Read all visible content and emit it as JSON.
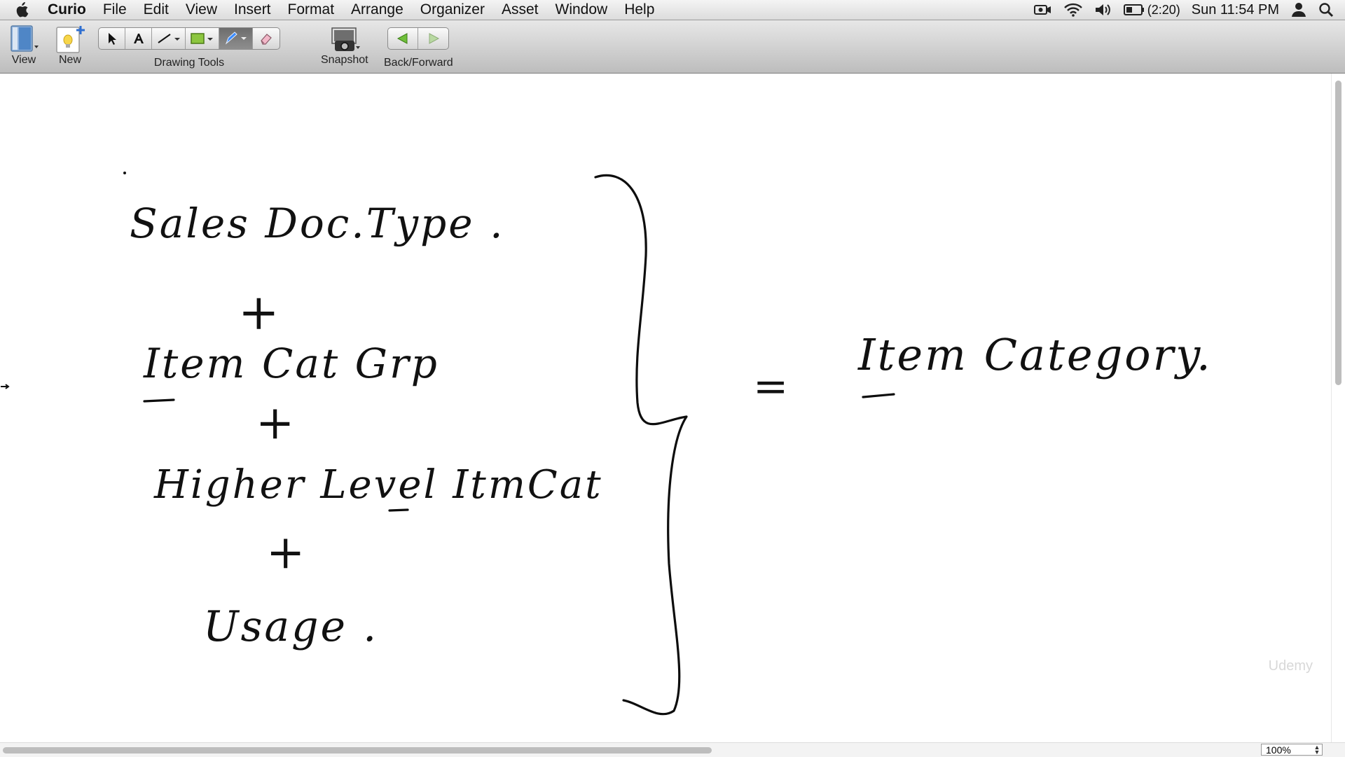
{
  "menubar": {
    "app_name": "Curio",
    "items": [
      "File",
      "Edit",
      "View",
      "Insert",
      "Format",
      "Arrange",
      "Organizer",
      "Asset",
      "Window",
      "Help"
    ],
    "battery": "(2:20)",
    "clock": "Sun 11:54 PM",
    "icons": [
      "apple-icon",
      "screen-record-icon",
      "wifi-icon",
      "volume-icon",
      "battery-icon",
      "user-icon",
      "spotlight-search-icon"
    ]
  },
  "toolbar": {
    "view_label": "View",
    "new_label": "New",
    "drawing_tools_label": "Drawing Tools",
    "snapshot_label": "Snapshot",
    "back_forward_label": "Back/Forward",
    "tools": [
      "select-tool-icon",
      "text-tool-icon",
      "line-tool-icon",
      "shape-tool-icon",
      "pen-tool-icon",
      "eraser-tool-icon"
    ],
    "shape_color": "#8cc63f"
  },
  "canvas": {
    "handwriting": {
      "line1": "Sales Doc.Type .",
      "plus1": "+",
      "line2": "Item Cat Grp",
      "plus2": "+",
      "line3": "Higher Level  ItmCat",
      "plus3": "+",
      "line4": "Usage .",
      "equals": "=",
      "result": "Item Category."
    },
    "watermark": "Udemy"
  },
  "status": {
    "zoom": "100%"
  }
}
